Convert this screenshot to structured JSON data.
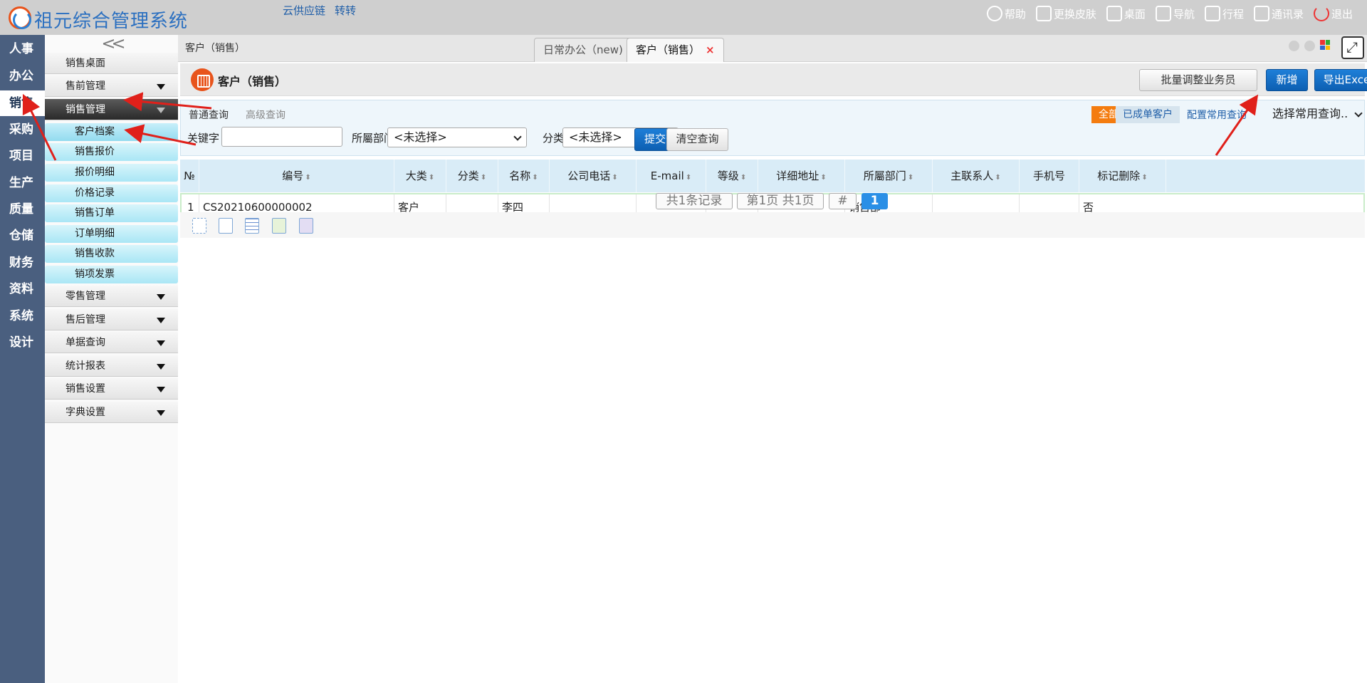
{
  "header": {
    "app_title": "祖元综合管理系统",
    "links": [
      "云供应链",
      "转转"
    ],
    "tools": [
      {
        "label": "帮助",
        "icon": "help-icon"
      },
      {
        "label": "更换皮肤",
        "icon": "shirt-icon"
      },
      {
        "label": "桌面",
        "icon": "home-icon"
      },
      {
        "label": "导航",
        "icon": "nav-grid-icon"
      },
      {
        "label": "行程",
        "icon": "calendar-icon"
      },
      {
        "label": "通讯录",
        "icon": "contacts-icon"
      },
      {
        "label": "退出",
        "icon": "power-icon"
      }
    ]
  },
  "modules": [
    "人事",
    "办公",
    "销售",
    "采购",
    "项目",
    "生产",
    "质量",
    "仓储",
    "财务",
    "资料",
    "系统",
    "设计"
  ],
  "active_module": "销售",
  "sidebar": {
    "collapse_glyph": "<<",
    "top_item": "销售桌面",
    "group_presale": "售前管理",
    "group_sales": "销售管理",
    "sales_items": [
      "客户档案",
      "销售报价",
      "报价明细",
      "价格记录",
      "销售订单",
      "订单明细",
      "销售收款",
      "销项发票"
    ],
    "groups_after": [
      "零售管理",
      "售后管理",
      "单据查询",
      "统计报表",
      "销售设置",
      "字典设置"
    ]
  },
  "tabs_bar": {
    "breadcrumb": "客户（销售）",
    "tabs": [
      {
        "label": "日常办公（new)"
      },
      {
        "label": "客户（销售）",
        "close": "×"
      }
    ]
  },
  "page": {
    "title": "客户（销售）",
    "btn_batch": "批量调整业务员",
    "btn_add": "新增",
    "btn_export": "导出Excel"
  },
  "search": {
    "mode_normal": "普通查询",
    "mode_advanced": "高级查询",
    "keyword_label": "关键字",
    "keyword_value": "",
    "dept_label": "所屬部门",
    "dept_value": "<未选择>",
    "category_label": "分类",
    "category_value": "<未选择>",
    "submit_label": "提交查询",
    "clear_label": "清空查询",
    "filter_all": "全部",
    "filter_done": "已成单客户",
    "config_link": "配置常用查询",
    "common_query": "选择常用查询.."
  },
  "grid": {
    "columns": [
      "№",
      "编号",
      "大类",
      "分类",
      "名称",
      "公司电话",
      "E-mail",
      "等级",
      "详细地址",
      "所屬部门",
      "主联系人",
      "手机号",
      "标记删除"
    ],
    "sortable": [
      false,
      true,
      true,
      true,
      true,
      true,
      true,
      true,
      true,
      true,
      true,
      false,
      true
    ],
    "rows": [
      [
        "1",
        "CS20210600000002",
        "客户",
        "",
        "李四",
        "",
        "",
        "",
        "",
        "销售部",
        "",
        "",
        "否"
      ]
    ]
  },
  "pager": {
    "total": "共1条记录",
    "page_info": "第1页 共1页",
    "hash": "#",
    "current": "1"
  },
  "colors": {
    "accent_blue": "#0d5fb2",
    "brand_orange": "#e8541c",
    "module_bar": "#4a5f7f",
    "annotation_red": "#e0201a"
  }
}
